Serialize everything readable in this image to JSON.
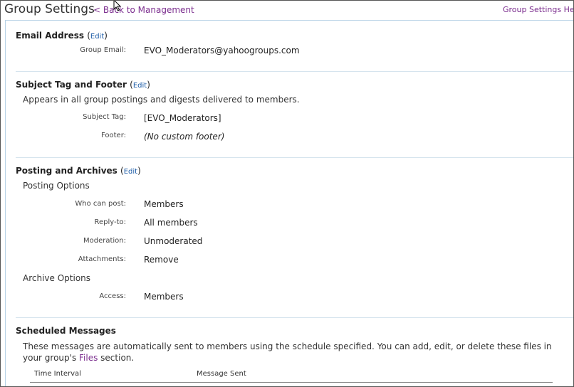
{
  "header": {
    "title": "Group Settings",
    "back_link": "< Back to Management",
    "help_link": "Group Settings He"
  },
  "email_section": {
    "title": "Email Address",
    "edit_label": "Edit",
    "fields": [
      {
        "label": "Group Email:",
        "value": "EVO_Moderators@yahoogroups.com"
      }
    ]
  },
  "subject_section": {
    "title": "Subject Tag and Footer",
    "edit_label": "Edit",
    "description": "Appears in all group postings and digests delivered to members.",
    "fields": [
      {
        "label": "Subject Tag:",
        "value": "[EVO_Moderators]"
      },
      {
        "label": "Footer:",
        "value": "(No custom footer)"
      }
    ]
  },
  "posting_section": {
    "title": "Posting and Archives",
    "edit_label": "Edit",
    "posting_options_title": "Posting Options",
    "posting_fields": [
      {
        "label": "Who can post:",
        "value": "Members"
      },
      {
        "label": "Reply-to:",
        "value": "All members"
      },
      {
        "label": "Moderation:",
        "value": "Unmoderated"
      },
      {
        "label": "Attachments:",
        "value": "Remove"
      }
    ],
    "archive_options_title": "Archive Options",
    "archive_fields": [
      {
        "label": "Access:",
        "value": "Members"
      }
    ]
  },
  "scheduled_section": {
    "title": "Scheduled Messages",
    "description_before": "These messages are automatically sent to members using the schedule specified. You can add, edit, or delete these files in your group's ",
    "files_link": "Files",
    "description_after": " section.",
    "columns": [
      "Time Interval",
      "Message Sent"
    ]
  }
}
